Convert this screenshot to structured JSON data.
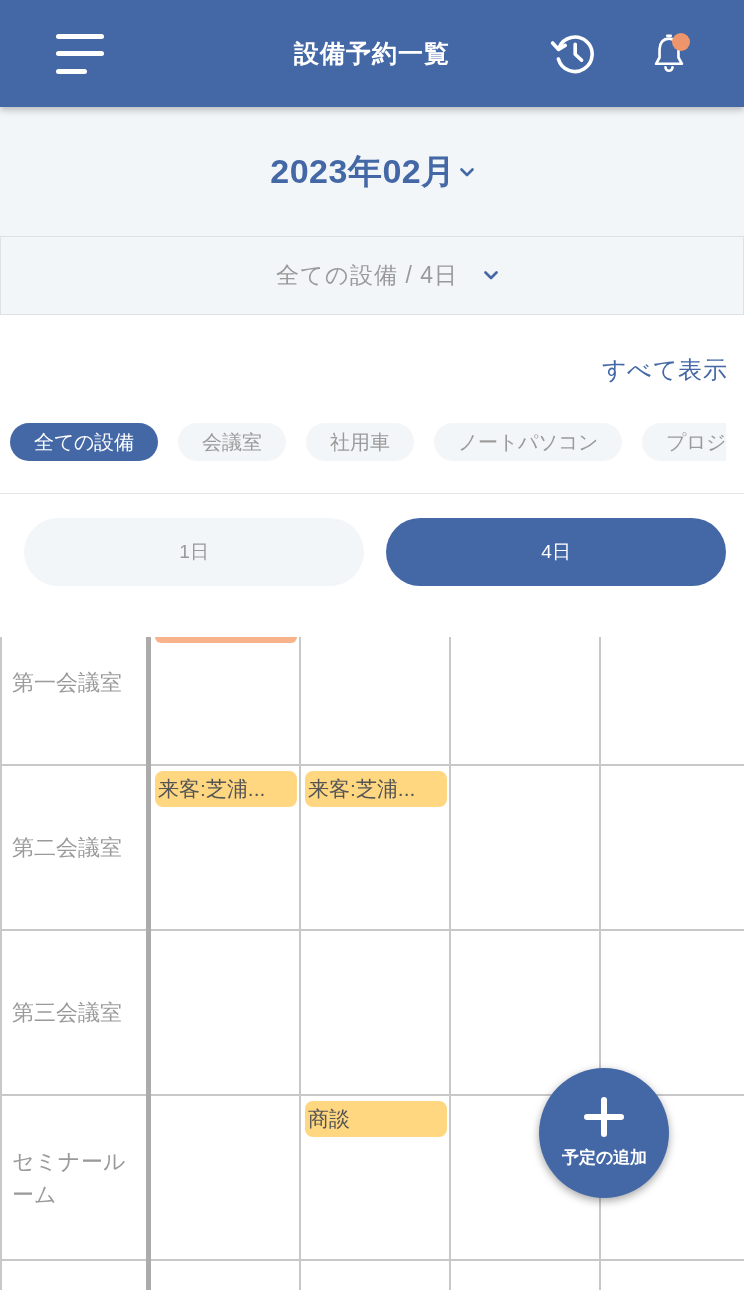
{
  "header": {
    "title": "設備予約一覧",
    "has_notification": true
  },
  "month_picker": {
    "label": "2023年02月"
  },
  "filter_dropdown": {
    "label": "全ての設備 / 4日"
  },
  "show_all_link": {
    "label": "すべて表示"
  },
  "categories": [
    {
      "label": "全ての設備",
      "selected": true
    },
    {
      "label": "会議室",
      "selected": false
    },
    {
      "label": "社用車",
      "selected": false
    },
    {
      "label": "ノートパソコン",
      "selected": false
    },
    {
      "label": "プロジ",
      "selected": false
    }
  ],
  "view_toggle": [
    {
      "label": "1日",
      "selected": false
    },
    {
      "label": "4日",
      "selected": true
    }
  ],
  "schedule": {
    "rows": [
      {
        "name": "第一会議室",
        "cells": [
          {
            "events": [
              {
                "color": "#f9b38a"
              }
            ]
          },
          {},
          {},
          {}
        ]
      },
      {
        "name": "第二会議室",
        "cells": [
          {
            "events": [
              {
                "title": "来客:芝浦...",
                "color": "#ffd780"
              }
            ]
          },
          {
            "events": [
              {
                "title": "来客:芝浦...",
                "color": "#ffd780"
              }
            ]
          },
          {},
          {}
        ]
      },
      {
        "name": "第三会議室",
        "cells": [
          {},
          {},
          {},
          {}
        ]
      },
      {
        "name": "セミナールーム",
        "cells": [
          {},
          {
            "events": [
              {
                "title": "商談",
                "color": "#ffd780"
              }
            ]
          },
          {},
          {}
        ]
      }
    ]
  },
  "add_button": {
    "label": "予定の追加"
  }
}
